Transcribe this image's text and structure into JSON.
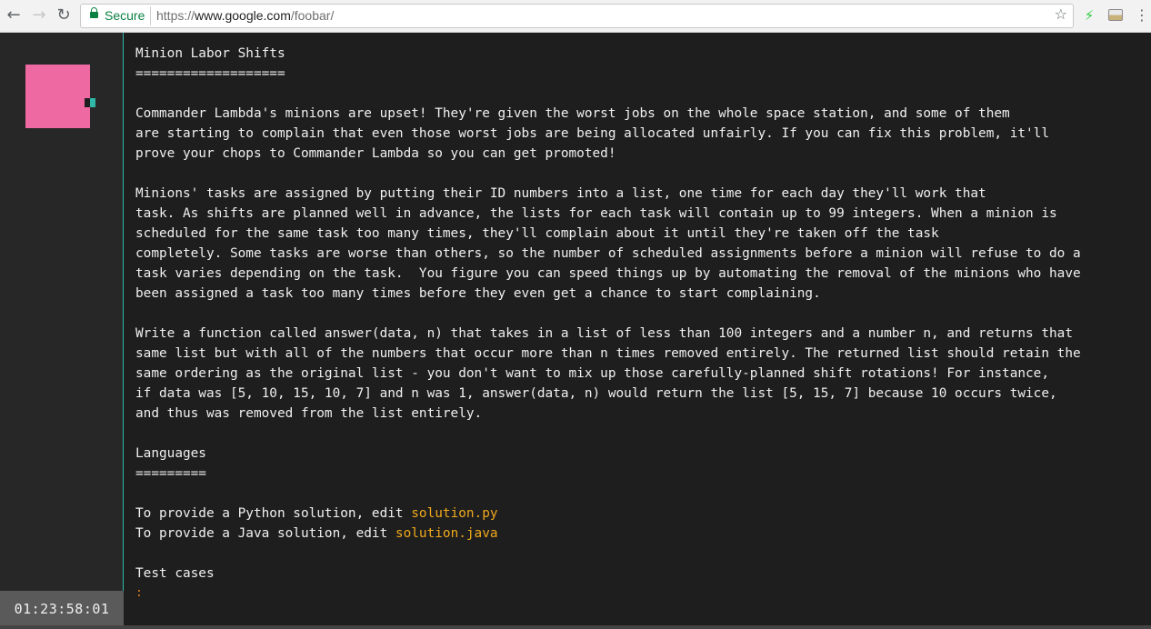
{
  "browser": {
    "back_icon": "arrow-back-icon",
    "forward_icon": "arrow-forward-icon",
    "reload_icon": "reload-icon",
    "secure_label": "Secure",
    "url_scheme": "https://",
    "url_host": "www.google.com",
    "url_path": "/foobar/",
    "bookmark_icon": "star-icon",
    "extension_icons": [
      "bolt-icon",
      "image-icon"
    ],
    "menu_icon": "kebab-menu-icon"
  },
  "sidebar": {
    "timer": "01:23:58:01",
    "accent_color": "#2fb8a8",
    "avatar_color": "#ee68a2"
  },
  "terminal": {
    "title": "Minion Labor Shifts",
    "title_underline": "===================",
    "paragraph1": [
      "Commander Lambda's minions are upset! They're given the worst jobs on the whole space station, and some of them",
      "are starting to complain that even those worst jobs are being allocated unfairly. If you can fix this problem, it'll",
      "prove your chops to Commander Lambda so you can get promoted!"
    ],
    "paragraph2": [
      "Minions' tasks are assigned by putting their ID numbers into a list, one time for each day they'll work that",
      "task. As shifts are planned well in advance, the lists for each task will contain up to 99 integers. When a minion is",
      "scheduled for the same task too many times, they'll complain about it until they're taken off the task",
      "completely. Some tasks are worse than others, so the number of scheduled assignments before a minion will refuse to do a",
      "task varies depending on the task.  You figure you can speed things up by automating the removal of the minions who have",
      "been assigned a task too many times before they even get a chance to start complaining."
    ],
    "paragraph3": [
      "Write a function called answer(data, n) that takes in a list of less than 100 integers and a number n, and returns that",
      "same list but with all of the numbers that occur more than n times removed entirely. The returned list should retain the",
      "same ordering as the original list - you don't want to mix up those carefully-planned shift rotations! For instance,",
      "if data was [5, 10, 15, 10, 7] and n was 1, answer(data, n) would return the list [5, 15, 7] because 10 occurs twice,",
      "and thus was removed from the list entirely."
    ],
    "languages_heading": "Languages",
    "languages_underline": "=========",
    "python_prefix": "To provide a Python solution, edit ",
    "python_file": "solution.py",
    "java_prefix": "To provide a Java solution, edit ",
    "java_file": "solution.java",
    "test_cases_heading": "Test cases",
    "prompt": ":",
    "file_color": "#f0a81d"
  }
}
